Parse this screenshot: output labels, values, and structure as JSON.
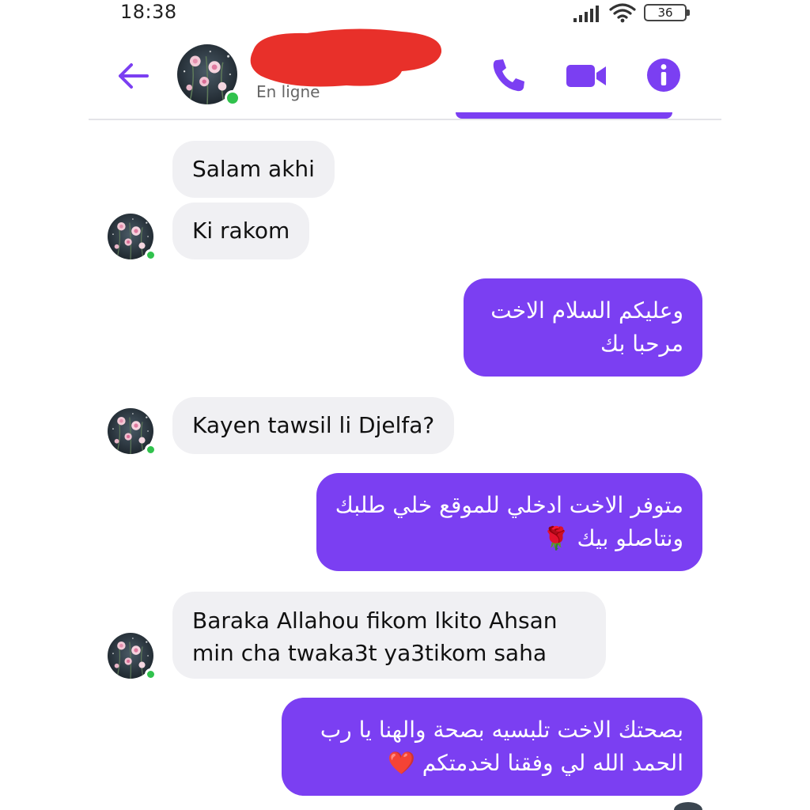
{
  "status_bar": {
    "time": "18:38",
    "battery_level": "36",
    "icons": [
      "signal-icon",
      "wifi-icon",
      "battery-icon"
    ]
  },
  "header": {
    "presence": "En ligne",
    "contact_name": "",
    "icons": [
      "back-arrow-icon",
      "phone-icon",
      "video-camera-icon",
      "info-icon"
    ],
    "accent_color": "#7b3ff2",
    "redaction_color": "#e8302a"
  },
  "colors": {
    "outgoing_bubble": "#7b3ff2",
    "incoming_bubble": "#f0f0f3",
    "online_dot": "#31c24d"
  },
  "messages": [
    {
      "direction": "incoming",
      "lines": [
        "Salam akhi"
      ]
    },
    {
      "direction": "incoming",
      "lines": [
        "Ki rakom"
      ]
    },
    {
      "direction": "outgoing",
      "lines": [
        "وعليكم السلام الاخت",
        "مرحبا بك"
      ]
    },
    {
      "direction": "incoming",
      "lines": [
        "Kayen tawsil li Djelfa?"
      ]
    },
    {
      "direction": "outgoing",
      "lines": [
        "متوفر الاخت ادخلي للموقع خلي طلبك",
        "ونتاصلو بيك 🌹"
      ]
    },
    {
      "direction": "incoming",
      "lines": [
        "Baraka Allahou fikom lkito Ahsan",
        "min cha twaka3t ya3tikom saha"
      ]
    },
    {
      "direction": "outgoing",
      "lines": [
        "بصحتك الاخت تلبسيه بصحة والهنا يا رب",
        "الحمد الله لي وفقنا لخدمتكم ❤️"
      ]
    }
  ]
}
